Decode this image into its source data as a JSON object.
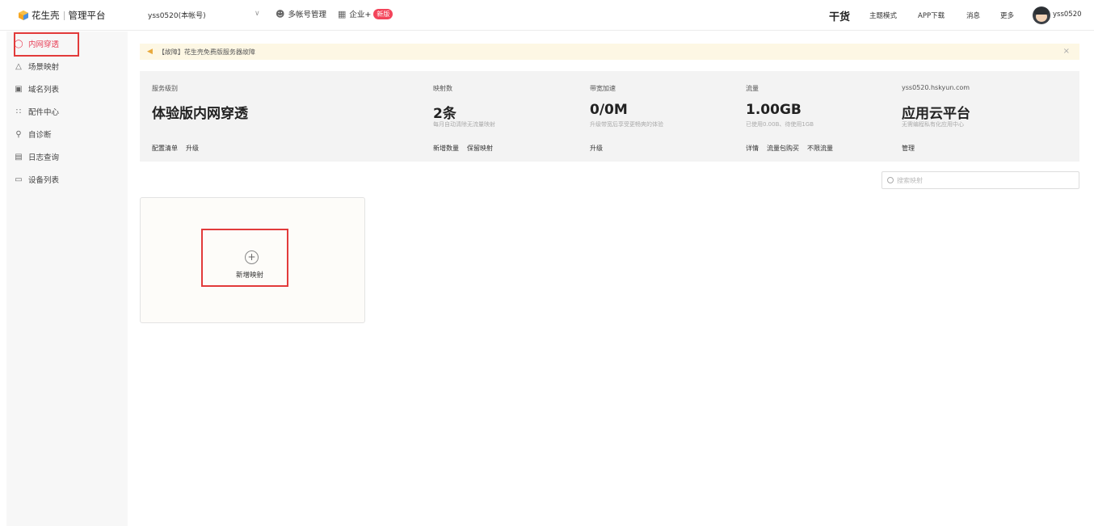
{
  "header": {
    "brand_name": "花生壳",
    "brand_sub": "管理平台",
    "account": "yss0520(本帐号)",
    "multi_account": "多帐号管理",
    "enterprise": "企业+",
    "new_badge": "新版",
    "gan": "干货",
    "theme": "主题模式",
    "app_download": "APP下载",
    "messages": "消息",
    "more": "更多",
    "username": "yss0520"
  },
  "sidebar": {
    "items": [
      {
        "label": "内网穿透",
        "icon": "cube-icon"
      },
      {
        "label": "场景映射",
        "icon": "scene-icon"
      },
      {
        "label": "域名列表",
        "icon": "domain-icon"
      },
      {
        "label": "配件中心",
        "icon": "grid-icon"
      },
      {
        "label": "自诊断",
        "icon": "diagnose-icon"
      },
      {
        "label": "日志查询",
        "icon": "log-icon"
      },
      {
        "label": "设备列表",
        "icon": "device-icon"
      }
    ]
  },
  "notice": {
    "text": "【故障】花生壳免费版服务器故障"
  },
  "stats": {
    "level": {
      "label": "服务级别",
      "value": "体验版内网穿透",
      "link1": "配置清单",
      "link2": "升级"
    },
    "mappings": {
      "label": "映射数",
      "value": "2条",
      "sub": "每月自动清除无流量映射",
      "link1": "新增数量",
      "link2": "保留映射"
    },
    "bandwidth": {
      "label": "带宽加速",
      "value": "0/0M",
      "sub": "升级带宽后享受更畅爽的体验",
      "link1": "升级"
    },
    "traffic": {
      "label": "流量",
      "value": "1.00GB",
      "sub": "已使用0.00B、待使用1GB",
      "link1": "详情",
      "link2": "流量包购买",
      "link3": "不限流量"
    },
    "cloud": {
      "label": "yss0520.hskyun.com",
      "value": "应用云平台",
      "sub": "无需编程私有化应用中心",
      "link1": "管理"
    }
  },
  "search": {
    "placeholder": "搜索映射"
  },
  "add_card": {
    "plus": "+",
    "label": "新增映射"
  },
  "colors": {
    "accent": "#e83e56",
    "highlight_box": "#e23b3b",
    "notice_bg": "#fdf7e4",
    "stats_bg": "#f3f3f3"
  }
}
